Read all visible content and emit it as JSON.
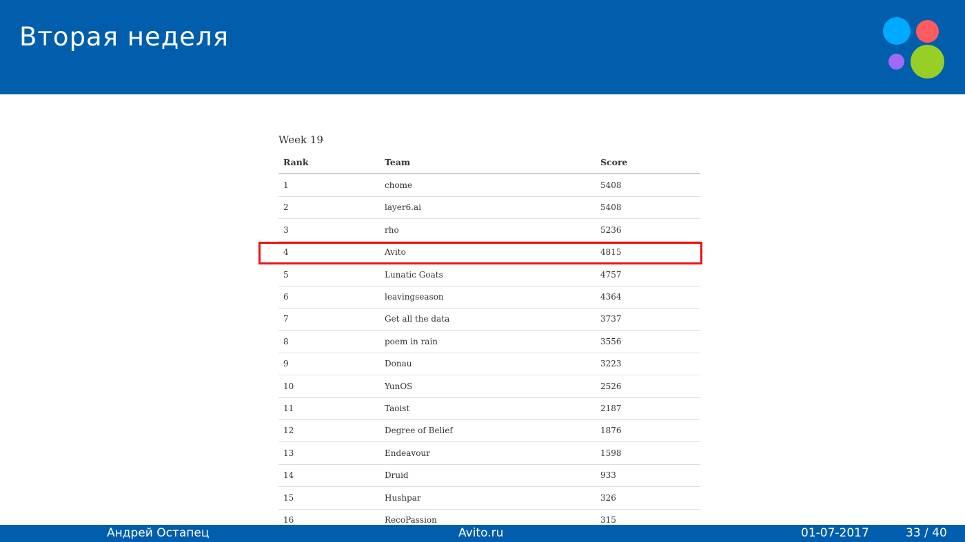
{
  "slide": {
    "title": "Вторая неделя"
  },
  "leaderboard": {
    "week_title": "Week 19",
    "headers": {
      "rank": "Rank",
      "team": "Team",
      "score": "Score"
    },
    "highlight_rank": "4",
    "highlight_color": "#ee1111",
    "rows": [
      {
        "rank": "1",
        "team": "chome",
        "score": "5408"
      },
      {
        "rank": "2",
        "team": "layer6.ai",
        "score": "5408"
      },
      {
        "rank": "3",
        "team": "rho",
        "score": "5236"
      },
      {
        "rank": "4",
        "team": "Avito",
        "score": "4815"
      },
      {
        "rank": "5",
        "team": "Lunatic Goats",
        "score": "4757"
      },
      {
        "rank": "6",
        "team": "leavingseason",
        "score": "4364"
      },
      {
        "rank": "7",
        "team": "Get all the data",
        "score": "3737"
      },
      {
        "rank": "8",
        "team": "poem in rain",
        "score": "3556"
      },
      {
        "rank": "9",
        "team": "Donau",
        "score": "3223"
      },
      {
        "rank": "10",
        "team": "YunOS",
        "score": "2526"
      },
      {
        "rank": "11",
        "team": "Taoist",
        "score": "2187"
      },
      {
        "rank": "12",
        "team": "Degree of Belief",
        "score": "1876"
      },
      {
        "rank": "13",
        "team": "Endeavour",
        "score": "1598"
      },
      {
        "rank": "14",
        "team": "Druid",
        "score": "933"
      },
      {
        "rank": "15",
        "team": "Hushpar",
        "score": "326"
      },
      {
        "rank": "16",
        "team": "RecoPassion",
        "score": "315"
      }
    ]
  },
  "footer": {
    "author": "Андрей Остапец",
    "site": "Avito.ru",
    "date": "01-07-2017",
    "page": "33 / 40"
  },
  "colors": {
    "brand_blue": "#005eac",
    "logo_blue": "#00aaff",
    "logo_red": "#ff5a5f",
    "logo_purple": "#a169f7",
    "logo_green": "#97cf26"
  }
}
